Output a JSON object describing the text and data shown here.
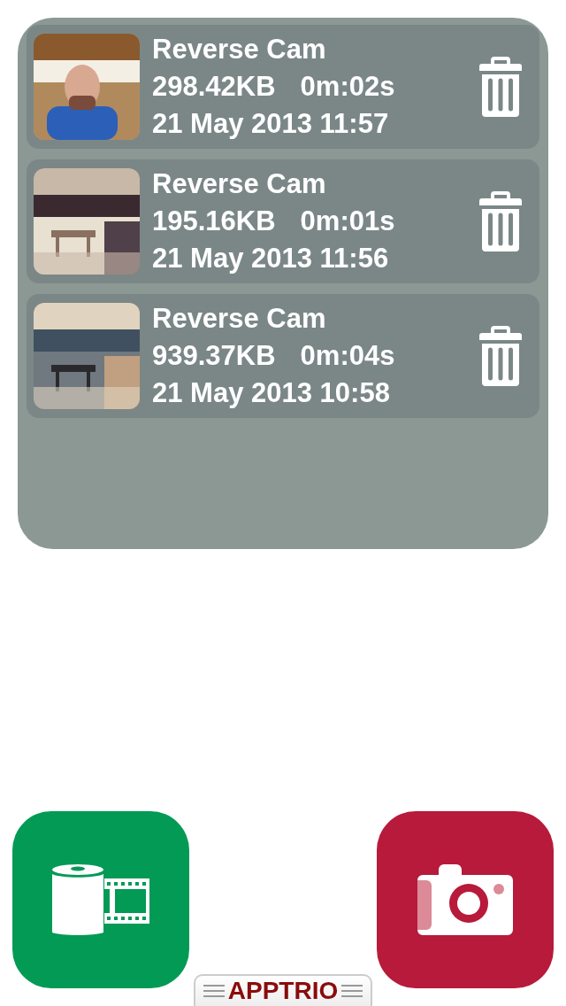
{
  "recordings": [
    {
      "title": "Reverse Cam",
      "size": "298.42KB",
      "duration": "0m:02s",
      "date": "21 May 2013 11:57"
    },
    {
      "title": "Reverse Cam",
      "size": "195.16KB",
      "duration": "0m:01s",
      "date": "21 May 2013 11:56"
    },
    {
      "title": "Reverse Cam",
      "size": "939.37KB",
      "duration": "0m:04s",
      "date": "21 May 2013 10:58"
    }
  ],
  "actions": [
    {
      "kind": "gallery",
      "color": "#029a55"
    },
    {
      "kind": "camera",
      "color": "#b71a3a"
    }
  ],
  "brand": {
    "label": "APPTRIO"
  }
}
